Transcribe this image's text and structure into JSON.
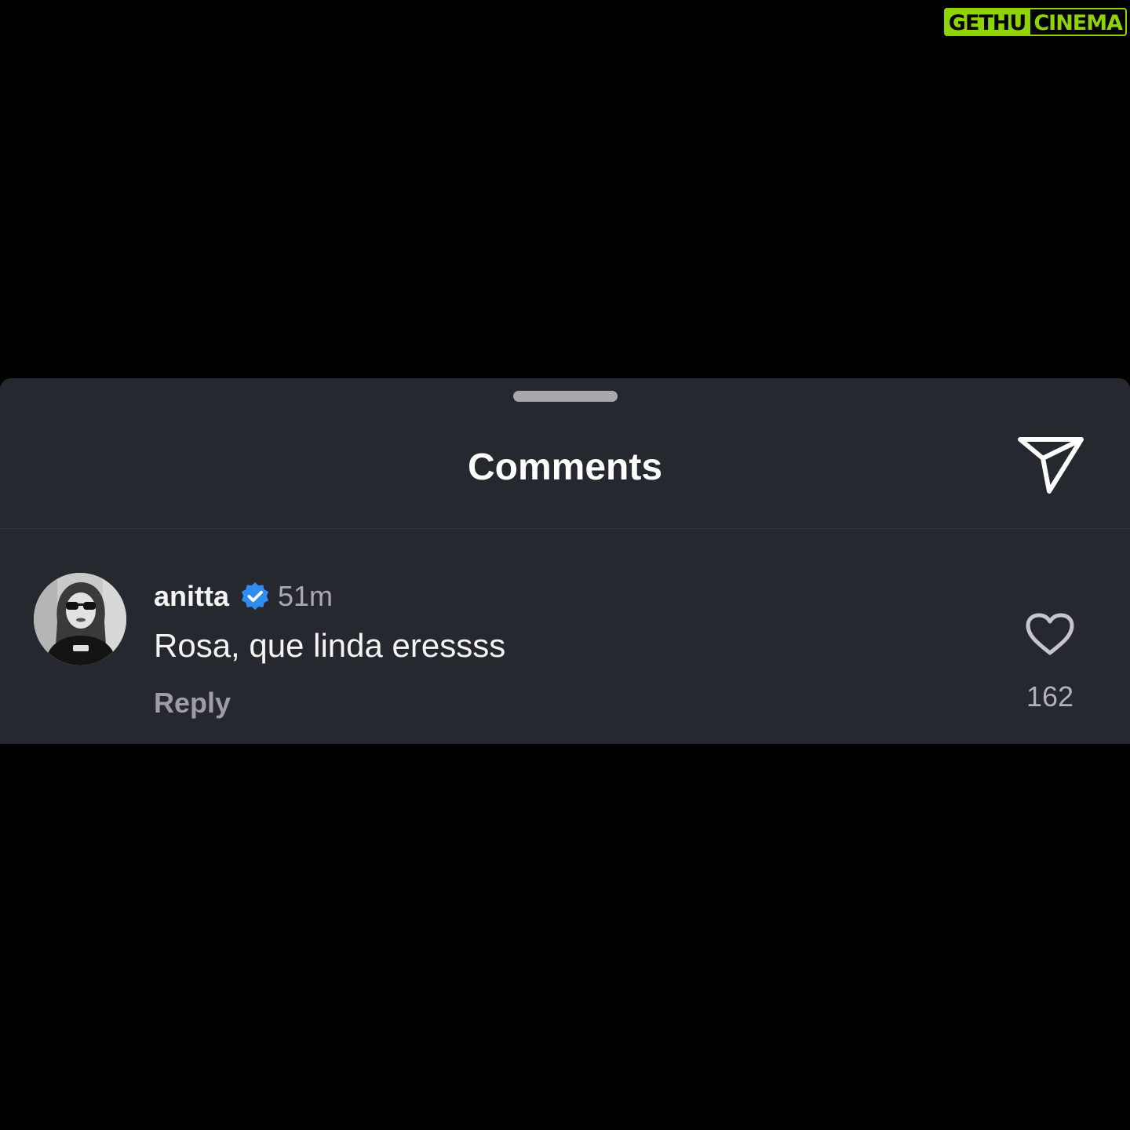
{
  "watermark": {
    "part1": "GETHU",
    "part2": "CINEMA"
  },
  "sheet": {
    "title": "Comments",
    "share_icon": "paper-plane-icon"
  },
  "comment": {
    "username": "anitta",
    "verified_icon": "verified-badge-icon",
    "time": "51m",
    "text": "Rosa, que linda eressss",
    "reply_label": "Reply",
    "like_icon": "heart-outline-icon",
    "like_count": "162"
  },
  "colors": {
    "background": "#000000",
    "sheet": "#26282f",
    "verified_blue": "#2f8cf0",
    "watermark_green": "#8fd400"
  }
}
